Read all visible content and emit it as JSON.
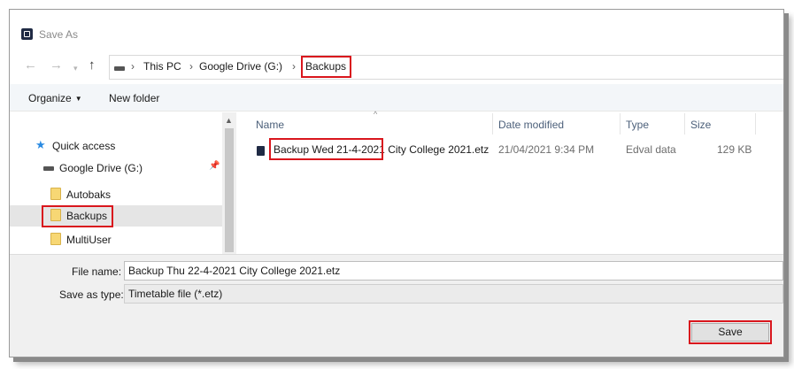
{
  "window": {
    "title": "Save As"
  },
  "nav": {
    "back_icon": "←",
    "forward_icon": "→",
    "recent_icon": "▾",
    "up_icon": "↑",
    "breadcrumbs": [
      "This PC",
      "Google Drive (G:)",
      "Backups"
    ],
    "separator": "›"
  },
  "toolbar": {
    "organize_label": "Organize",
    "organize_caret": "▼",
    "new_folder_label": "New folder"
  },
  "sidebar": {
    "scroll_up_icon": "▲",
    "pin_icon": "📌",
    "star_icon": "★",
    "items": [
      {
        "label": "Quick access",
        "icon": "star-icon"
      },
      {
        "label": "Google Drive (G:)",
        "icon": "drive-icon",
        "pinned": true
      },
      {
        "label": "Autobaks",
        "icon": "folder-icon"
      },
      {
        "label": "Backups",
        "icon": "folder-icon",
        "selected": true
      },
      {
        "label": "MultiUser",
        "icon": "folder-icon"
      }
    ]
  },
  "file_list": {
    "sort_caret": "^",
    "columns": [
      "Name",
      "Date modified",
      "Type",
      "Size"
    ],
    "rows": [
      {
        "name_highlighted": "Backup Wed 21-4-2021",
        "name_rest": " City College 2021.etz",
        "date": "21/04/2021 9:34 PM",
        "type": "Edval data",
        "size": "129 KB"
      }
    ]
  },
  "form": {
    "file_name_label": "File name:",
    "file_name_value": "Backup Thu 22-4-2021 City College 2021.etz",
    "save_type_label": "Save as type:",
    "save_type_value": "Timetable file (*.etz)"
  },
  "actions": {
    "save_label": "Save"
  },
  "colors": {
    "highlight": "#d9161d",
    "folder": "#f7d774",
    "quick_access": "#2a8ae2"
  }
}
